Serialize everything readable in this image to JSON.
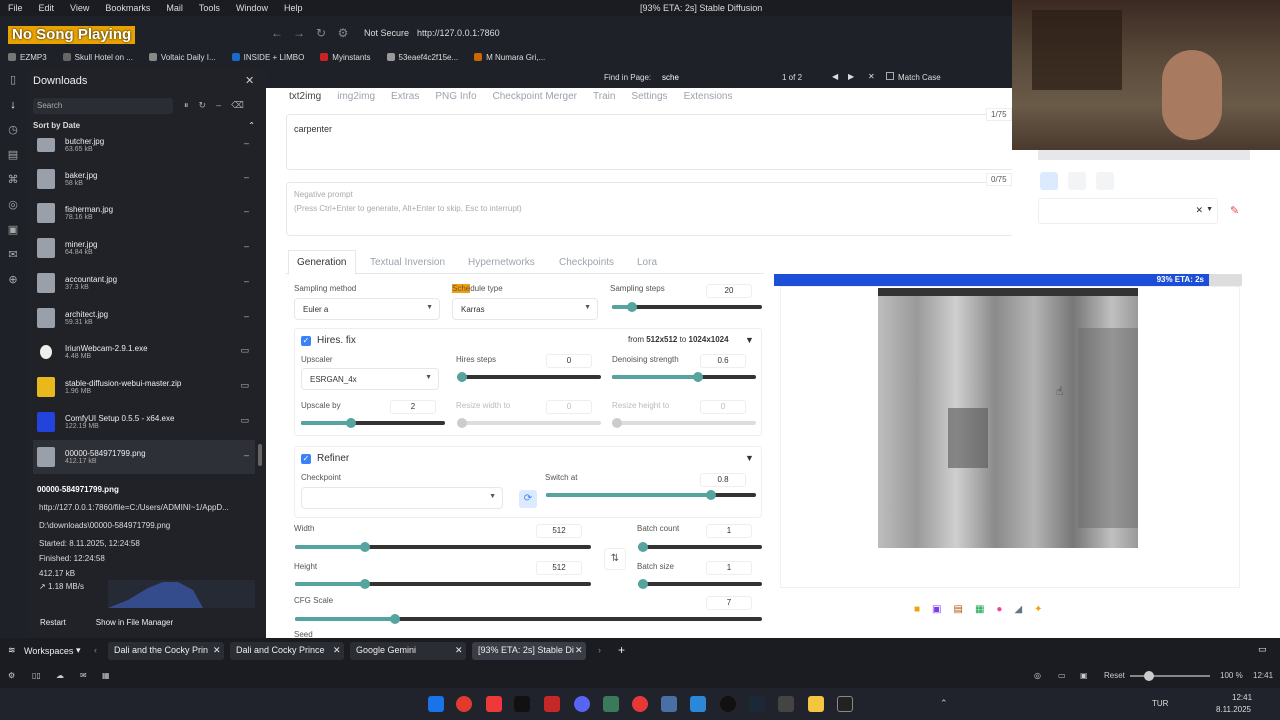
{
  "menubar": {
    "items": [
      "File",
      "Edit",
      "View",
      "Bookmarks",
      "Mail",
      "Tools",
      "Window",
      "Help"
    ],
    "title": "[93% ETA: 2s] Stable Diffusion"
  },
  "overlay": {
    "now_playing": "No Song Playing"
  },
  "browser": {
    "not_secure": "Not Secure",
    "url": "http://127.0.0.1:7860"
  },
  "bookmarks": [
    "EZMP3",
    "Skull Hotel on ...",
    "Voltaic Daily I...",
    "INSIDE + LIMBO",
    "Myinstants",
    "53eaef4c2f15e...",
    "M Numara Gri,..."
  ],
  "find": {
    "label": "Find in Page:",
    "query": "sche",
    "count": "1 of 2",
    "match_case": "Match Case"
  },
  "downloads": {
    "title": "Downloads",
    "search_placeholder": "Search",
    "sort": "Sort by Date",
    "items": [
      {
        "name": "butcher.jpg",
        "size": "63.65 kB"
      },
      {
        "name": "baker.jpg",
        "size": "58 kB"
      },
      {
        "name": "fisherman.jpg",
        "size": "78.16 kB"
      },
      {
        "name": "miner.jpg",
        "size": "64.84 kB"
      },
      {
        "name": "accountant.jpg",
        "size": "37.3 kB"
      },
      {
        "name": "architect.jpg",
        "size": "59.31 kB"
      },
      {
        "name": "IriunWebcam-2.9.1.exe",
        "size": "4.48 MB"
      },
      {
        "name": "stable-diffusion-webui-master.zip",
        "size": "1.96 MB"
      },
      {
        "name": "ComfyUI Setup 0.5.5 - x64.exe",
        "size": "122.19 MB"
      },
      {
        "name": "00000-584971799.png",
        "size": "412.17 kB"
      }
    ],
    "detail": {
      "name": "00000-584971799.png",
      "url": "http://127.0.0.1:7860/file=C:/Users/ADMINI~1/AppD...",
      "path": "D:\\downloads\\00000-584971799.png",
      "started": "Started:   8.11.2025, 12:24:58",
      "finished": "Finished:   12:24:58",
      "size": "412.17 kB",
      "speed": "1.18 MB/s"
    },
    "restart": "Restart",
    "show": "Show in File Manager"
  },
  "sd": {
    "tabs": [
      "txt2img",
      "img2img",
      "Extras",
      "PNG Info",
      "Checkpoint Merger",
      "Train",
      "Settings",
      "Extensions"
    ],
    "prompt": "carpenter",
    "prompt_count": "1/75",
    "neg_label": "Negative prompt",
    "neg_hint": "(Press Ctrl+Enter to generate, Alt+Enter to skip, Esc to interrupt)",
    "neg_count": "0/75",
    "gen_tabs": [
      "Generation",
      "Textual Inversion",
      "Hypernetworks",
      "Checkpoints",
      "Lora"
    ],
    "sampling_method_label": "Sampling method",
    "sampling_method": "Euler a",
    "schedule_hl": "Sche",
    "schedule_rest": "dule type",
    "schedule": "Karras",
    "steps_label": "Sampling steps",
    "steps": "20",
    "hires_label": "Hires. fix",
    "hires_from": "from",
    "hires_from_val": "512x512",
    "hires_to": "to",
    "hires_to_val": "1024x1024",
    "upscaler_label": "Upscaler",
    "upscaler": "ESRGAN_4x",
    "hires_steps_label": "Hires steps",
    "hires_steps": "0",
    "denoise_label": "Denoising strength",
    "denoise": "0.6",
    "upscale_by_label": "Upscale by",
    "upscale_by": "2",
    "resize_w_label": "Resize width to",
    "resize_w": "0",
    "resize_h_label": "Resize height to",
    "resize_h": "0",
    "refiner_label": "Refiner",
    "checkpoint_label": "Checkpoint",
    "switch_label": "Switch at",
    "switch": "0.8",
    "width_label": "Width",
    "width": "512",
    "height_label": "Height",
    "height": "512",
    "batch_count_label": "Batch count",
    "batch_count": "1",
    "batch_size_label": "Batch size",
    "batch_size": "1",
    "cfg_label": "CFG Scale",
    "cfg": "7",
    "seed_label": "Seed",
    "progress": "93% ETA: 2s",
    "progress_value": 0.93
  },
  "browser_tabs": {
    "workspaces": "Workspaces",
    "tabs": [
      "Dali and the Cocky Prin",
      "Dali and Cocky Prince",
      "Google Gemini",
      "[93% ETA: 2s] Stable Di"
    ]
  },
  "statusbar": {
    "reset": "Reset",
    "zoom": "100 %",
    "time": "12:41"
  },
  "tray": {
    "lang": "TUR",
    "time": "12:41",
    "date": "8.11.2025"
  }
}
